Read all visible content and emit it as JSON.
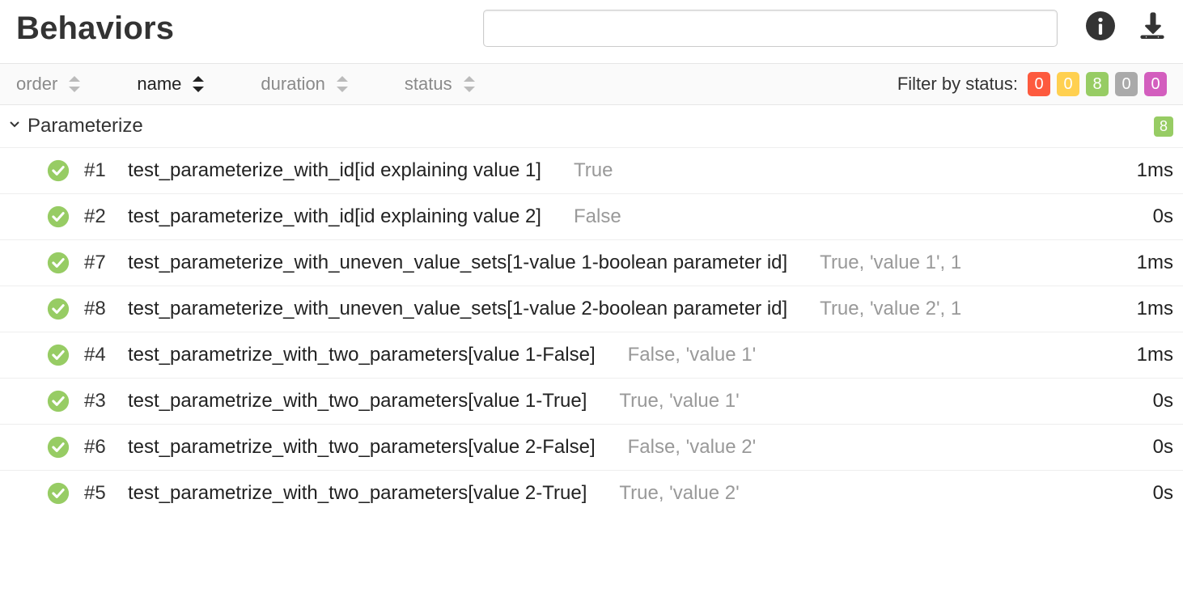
{
  "title": "Behaviors",
  "search": {
    "placeholder": ""
  },
  "sorters": {
    "order": {
      "label": "order",
      "active": false
    },
    "name": {
      "label": "name",
      "active": true
    },
    "duration": {
      "label": "duration",
      "active": false
    },
    "status": {
      "label": "status",
      "active": false
    }
  },
  "filter": {
    "label": "Filter by status:",
    "pills": [
      {
        "count": "0",
        "color": "#fd5a3e"
      },
      {
        "count": "0",
        "color": "#ffd050"
      },
      {
        "count": "8",
        "color": "#97cc64"
      },
      {
        "count": "0",
        "color": "#aaaaaa"
      },
      {
        "count": "0",
        "color": "#d35ebe"
      }
    ]
  },
  "group": {
    "name": "Parameterize",
    "count": "8"
  },
  "icons": {
    "pass_color": "#97cc64"
  },
  "tests": [
    {
      "order": "#1",
      "name": "test_parameterize_with_id[id explaining value 1]",
      "params": "True",
      "duration": "1ms"
    },
    {
      "order": "#2",
      "name": "test_parameterize_with_id[id explaining value 2]",
      "params": "False",
      "duration": "0s"
    },
    {
      "order": "#7",
      "name": "test_parameterize_with_uneven_value_sets[1-value 1-boolean parameter id]",
      "params": "True, 'value 1', 1",
      "duration": "1ms"
    },
    {
      "order": "#8",
      "name": "test_parameterize_with_uneven_value_sets[1-value 2-boolean parameter id]",
      "params": "True, 'value 2', 1",
      "duration": "1ms"
    },
    {
      "order": "#4",
      "name": "test_parametrize_with_two_parameters[value 1-False]",
      "params": "False, 'value 1'",
      "duration": "1ms"
    },
    {
      "order": "#3",
      "name": "test_parametrize_with_two_parameters[value 1-True]",
      "params": "True, 'value 1'",
      "duration": "0s"
    },
    {
      "order": "#6",
      "name": "test_parametrize_with_two_parameters[value 2-False]",
      "params": "False, 'value 2'",
      "duration": "0s"
    },
    {
      "order": "#5",
      "name": "test_parametrize_with_two_parameters[value 2-True]",
      "params": "True, 'value 2'",
      "duration": "0s"
    }
  ]
}
